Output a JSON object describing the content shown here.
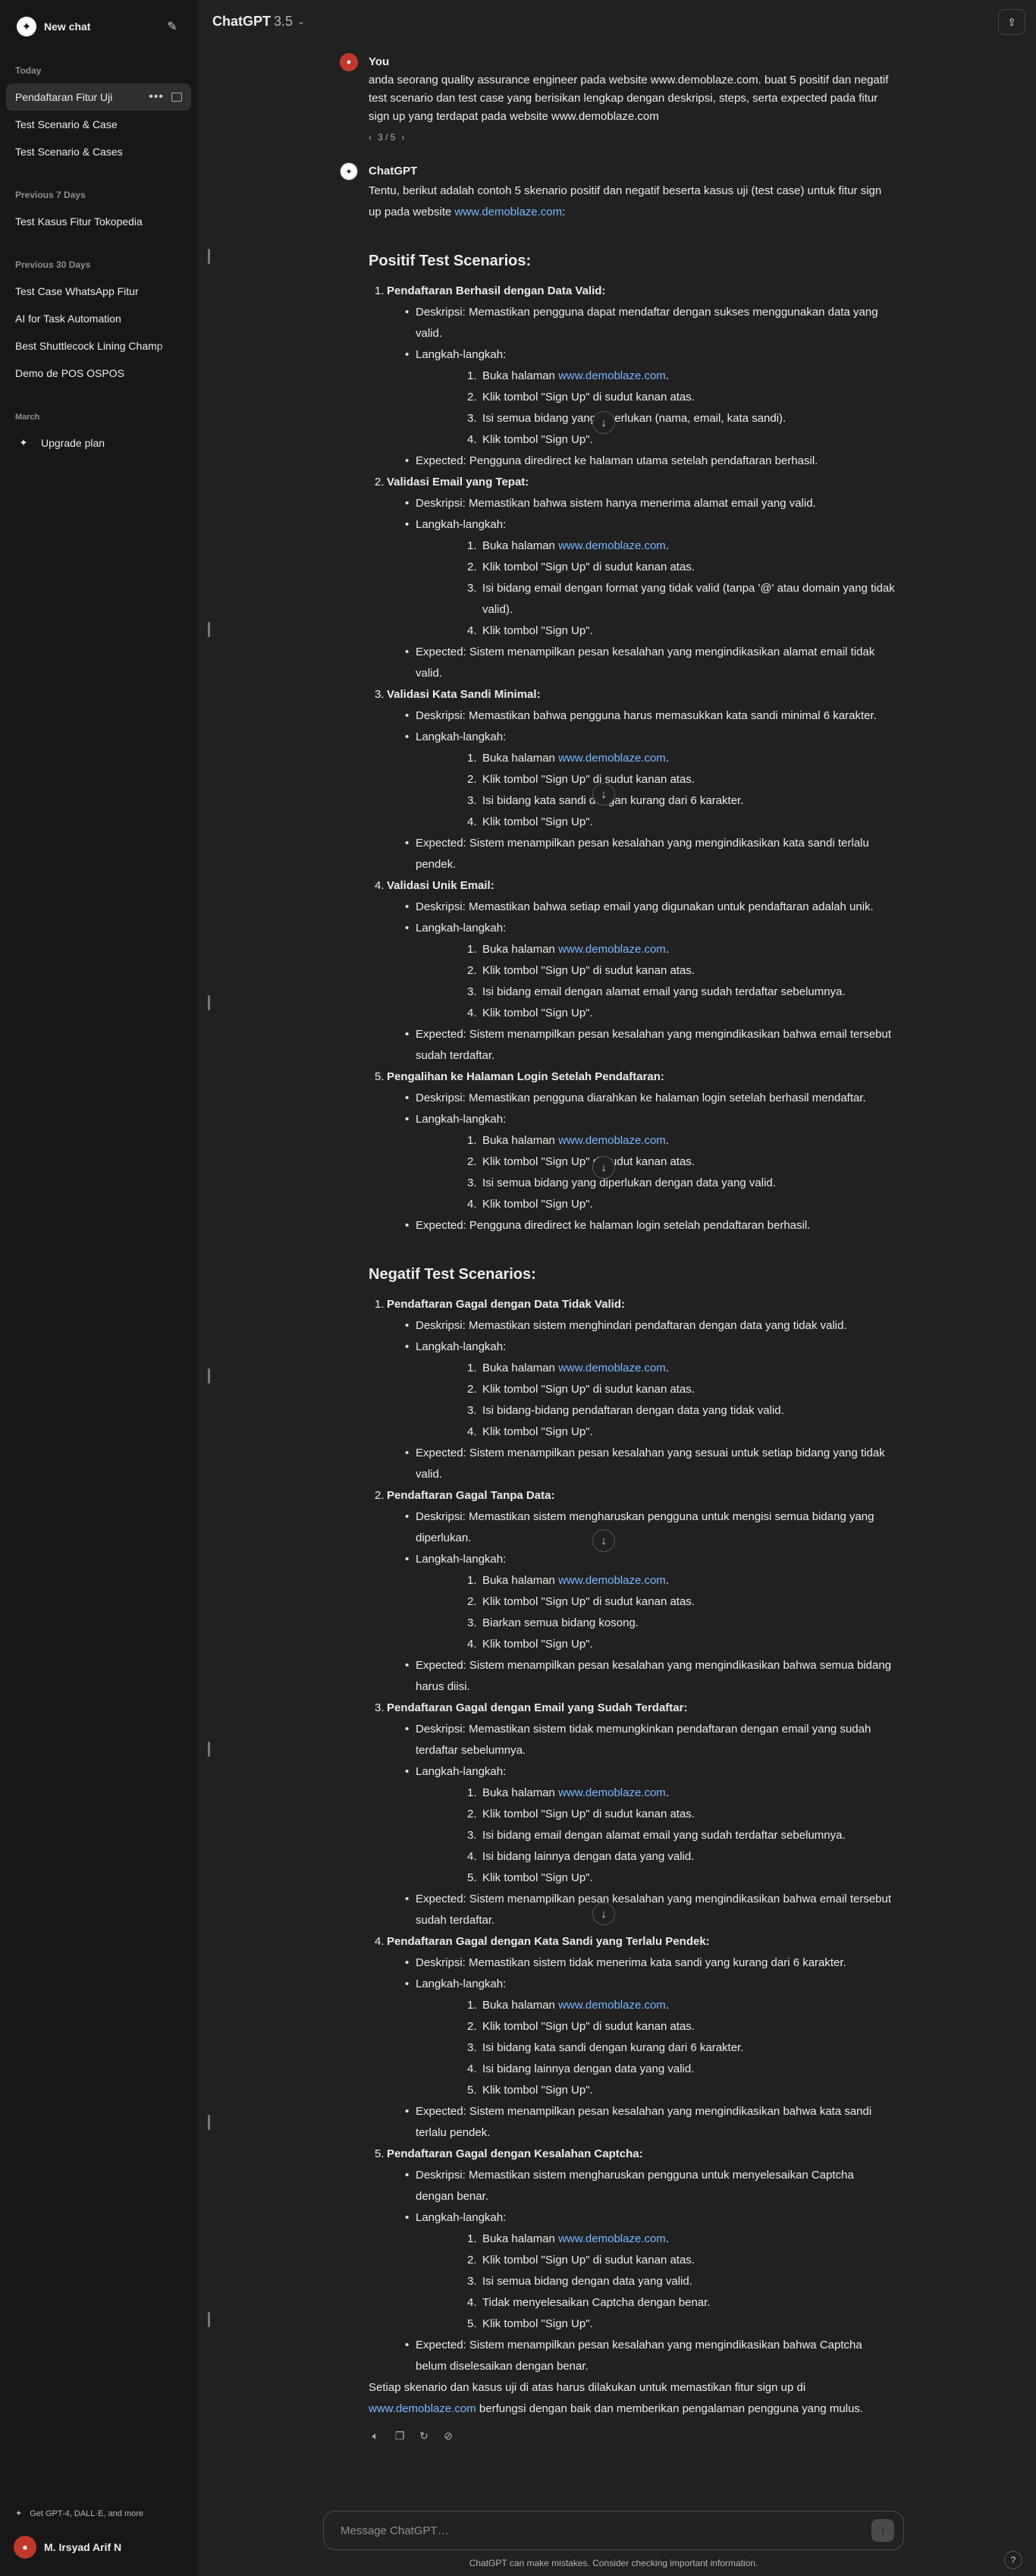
{
  "sidebar": {
    "new_chat": "New chat",
    "sections": [
      {
        "label": "Today",
        "items": [
          "Pendaftaran Fitur Uji",
          "Test Scenario & Case",
          "Test Scenario & Cases"
        ]
      },
      {
        "label": "Previous 7 Days",
        "items": [
          "Test Kasus Fitur Tokopedia"
        ]
      },
      {
        "label": "Previous 30 Days",
        "items": [
          "Test Case WhatsApp Fitur",
          "AI for Task Automation",
          "Best Shuttlecock Lining Champ",
          "Demo de POS OSPOS"
        ]
      },
      {
        "label": "March",
        "items": []
      }
    ],
    "active_item": "Pendaftaran Fitur Uji",
    "upgrade": "Upgrade plan",
    "bottom_note": "Get GPT-4, DALL·E, and more",
    "user_name": "M. Irsyad Arif N"
  },
  "header": {
    "model": "ChatGPT",
    "version": "3.5"
  },
  "thread": {
    "user": {
      "author": "You",
      "text": "anda seorang quality assurance engineer pada website www.demoblaze.com. buat 5 positif dan negatif test scenario dan test case yang berisikan lengkap dengan deskripsi, steps, serta expected pada fitur sign up yang terdapat pada website www.demoblaze.com",
      "pager": "3 / 5"
    },
    "assistant": {
      "author": "ChatGPT",
      "intro_before": "Tentu, berikut adalah contoh 5 skenario positif dan negatif beserta kasus uji (test case) untuk fitur sign up pada website ",
      "intro_link": "www.demoblaze.com",
      "intro_after": ":",
      "positive_heading": "Positif Test Scenarios:",
      "negative_heading": "Negatif Test Scenarios:",
      "steps_label": "Langkah-langkah:",
      "link": "www.demoblaze.com",
      "positive": [
        {
          "title": "Pendaftaran Berhasil dengan Data Valid:",
          "desc": "Deskripsi: Memastikan pengguna dapat mendaftar dengan sukses menggunakan data yang valid.",
          "steps": [
            "Buka halaman {link}.",
            "Klik tombol \"Sign Up\" di sudut kanan atas.",
            "Isi semua bidang yang diperlukan (nama, email, kata sandi).",
            "Klik tombol \"Sign Up\"."
          ],
          "expected": "Expected: Pengguna diredirect ke halaman utama setelah pendaftaran berhasil."
        },
        {
          "title": "Validasi Email yang Tepat:",
          "desc": "Deskripsi: Memastikan bahwa sistem hanya menerima alamat email yang valid.",
          "steps": [
            "Buka halaman {link}.",
            "Klik tombol \"Sign Up\" di sudut kanan atas.",
            "Isi bidang email dengan format yang tidak valid (tanpa '@' atau domain yang tidak valid).",
            "Klik tombol \"Sign Up\"."
          ],
          "expected": "Expected: Sistem menampilkan pesan kesalahan yang mengindikasikan alamat email tidak valid."
        },
        {
          "title": "Validasi Kata Sandi Minimal:",
          "desc": "Deskripsi: Memastikan bahwa pengguna harus memasukkan kata sandi minimal 6 karakter.",
          "steps": [
            "Buka halaman {link}.",
            "Klik tombol \"Sign Up\" di sudut kanan atas.",
            "Isi bidang kata sandi dengan kurang dari 6 karakter.",
            "Klik tombol \"Sign Up\"."
          ],
          "expected": "Expected: Sistem menampilkan pesan kesalahan yang mengindikasikan kata sandi terlalu pendek."
        },
        {
          "title": "Validasi Unik Email:",
          "desc": "Deskripsi: Memastikan bahwa setiap email yang digunakan untuk pendaftaran adalah unik.",
          "steps": [
            "Buka halaman {link}.",
            "Klik tombol \"Sign Up\" di sudut kanan atas.",
            "Isi bidang email dengan alamat email yang sudah terdaftar sebelumnya.",
            "Klik tombol \"Sign Up\"."
          ],
          "expected": "Expected: Sistem menampilkan pesan kesalahan yang mengindikasikan bahwa email tersebut sudah terdaftar."
        },
        {
          "title": "Pengalihan ke Halaman Login Setelah Pendaftaran:",
          "desc": "Deskripsi: Memastikan pengguna diarahkan ke halaman login setelah berhasil mendaftar.",
          "steps": [
            "Buka halaman {link}.",
            "Klik tombol \"Sign Up\" di sudut kanan atas.",
            "Isi semua bidang yang diperlukan dengan data yang valid.",
            "Klik tombol \"Sign Up\"."
          ],
          "expected": "Expected: Pengguna diredirect ke halaman login setelah pendaftaran berhasil."
        }
      ],
      "negative": [
        {
          "title": "Pendaftaran Gagal dengan Data Tidak Valid:",
          "desc": "Deskripsi: Memastikan sistem menghindari pendaftaran dengan data yang tidak valid.",
          "steps": [
            "Buka halaman {link}.",
            "Klik tombol \"Sign Up\" di sudut kanan atas.",
            "Isi bidang-bidang pendaftaran dengan data yang tidak valid.",
            "Klik tombol \"Sign Up\"."
          ],
          "expected": "Expected: Sistem menampilkan pesan kesalahan yang sesuai untuk setiap bidang yang tidak valid."
        },
        {
          "title": "Pendaftaran Gagal Tanpa Data:",
          "desc": "Deskripsi: Memastikan sistem mengharuskan pengguna untuk mengisi semua bidang yang diperlukan.",
          "steps": [
            "Buka halaman {link}.",
            "Klik tombol \"Sign Up\" di sudut kanan atas.",
            "Biarkan semua bidang kosong.",
            "Klik tombol \"Sign Up\"."
          ],
          "expected": "Expected: Sistem menampilkan pesan kesalahan yang mengindikasikan bahwa semua bidang harus diisi."
        },
        {
          "title": "Pendaftaran Gagal dengan Email yang Sudah Terdaftar:",
          "desc": "Deskripsi: Memastikan sistem tidak memungkinkan pendaftaran dengan email yang sudah terdaftar sebelumnya.",
          "steps": [
            "Buka halaman {link}.",
            "Klik tombol \"Sign Up\" di sudut kanan atas.",
            "Isi bidang email dengan alamat email yang sudah terdaftar sebelumnya.",
            "Isi bidang lainnya dengan data yang valid.",
            "Klik tombol \"Sign Up\"."
          ],
          "expected": "Expected: Sistem menampilkan pesan kesalahan yang mengindikasikan bahwa email tersebut sudah terdaftar."
        },
        {
          "title": "Pendaftaran Gagal dengan Kata Sandi yang Terlalu Pendek:",
          "desc": "Deskripsi: Memastikan sistem tidak menerima kata sandi yang kurang dari 6 karakter.",
          "steps": [
            "Buka halaman {link}.",
            "Klik tombol \"Sign Up\" di sudut kanan atas.",
            "Isi bidang kata sandi dengan kurang dari 6 karakter.",
            "Isi bidang lainnya dengan data yang valid.",
            "Klik tombol \"Sign Up\"."
          ],
          "expected": "Expected: Sistem menampilkan pesan kesalahan yang mengindikasikan bahwa kata sandi terlalu pendek."
        },
        {
          "title": "Pendaftaran Gagal dengan Kesalahan Captcha:",
          "desc": "Deskripsi: Memastikan sistem mengharuskan pengguna untuk menyelesaikan Captcha dengan benar.",
          "steps": [
            "Buka halaman {link}.",
            "Klik tombol \"Sign Up\" di sudut kanan atas.",
            "Isi semua bidang dengan data yang valid.",
            "Tidak menyelesaikan Captcha dengan benar.",
            "Klik tombol \"Sign Up\"."
          ],
          "expected": "Expected: Sistem menampilkan pesan kesalahan yang mengindikasikan bahwa Captcha belum diselesaikan dengan benar."
        }
      ],
      "closing_before": "Setiap skenario dan kasus uji di atas harus dilakukan untuk memastikan fitur sign up di ",
      "closing_link": "www.demoblaze.com",
      "closing_after": " berfungsi dengan baik dan memberikan pengalaman pengguna yang mulus."
    }
  },
  "composer": {
    "placeholder": "Message ChatGPT…",
    "disclaimer": "ChatGPT can make mistakes. Consider checking important information.",
    "help": "?"
  },
  "colors": {
    "background": "#212121",
    "sidebar": "#171717",
    "link": "#7ab7ff"
  },
  "icons": [
    "openai-logo-icon",
    "edit-icon",
    "more-icon",
    "archive-icon",
    "sparkle-icon",
    "share-icon",
    "chevron-down-icon",
    "arrow-down-icon",
    "speaker-icon",
    "copy-icon",
    "regenerate-icon",
    "thumbs-down-icon",
    "send-icon"
  ]
}
